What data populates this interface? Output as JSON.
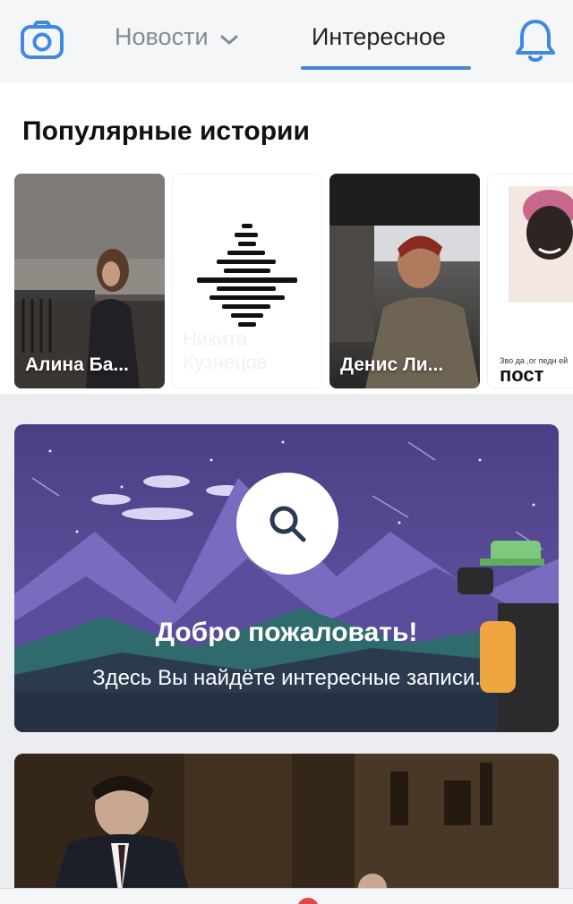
{
  "header": {
    "camera_icon": "camera-icon",
    "tabs": [
      {
        "label": "Новости",
        "has_dropdown": true,
        "active": false
      },
      {
        "label": "Интересное",
        "active": true
      }
    ],
    "bell_icon": "bell-icon",
    "accent_color": "#4a86cc"
  },
  "stories": {
    "title": "Популярные истории",
    "items": [
      {
        "name": "Алина Ба..."
      },
      {
        "name": "Никита Кузнецов"
      },
      {
        "name": "Денис Ли..."
      },
      {
        "name": "пост",
        "caption": "Зво да ,ог педн ей"
      }
    ]
  },
  "welcome": {
    "title": "Добро пожаловать!",
    "subtitle": "Здесь Вы найдёте интересные записи.",
    "search_icon": "search-icon"
  }
}
